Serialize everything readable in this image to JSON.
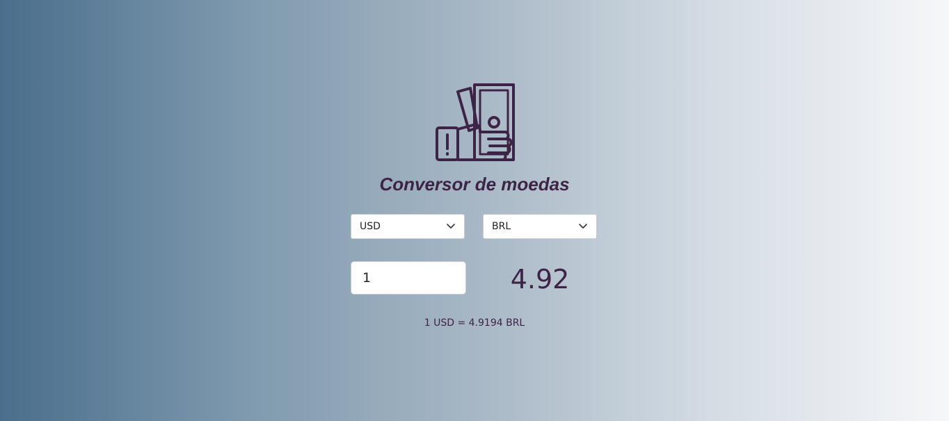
{
  "app": {
    "title": "Conversor de moedas",
    "logo_icon": "cash-in-hand-icon",
    "accent_color": "#3d2447"
  },
  "converter": {
    "from_currency": "USD",
    "to_currency": "BRL",
    "amount": "1",
    "result": "4.92",
    "rate_text": "1 USD = 4.9194 BRL"
  }
}
